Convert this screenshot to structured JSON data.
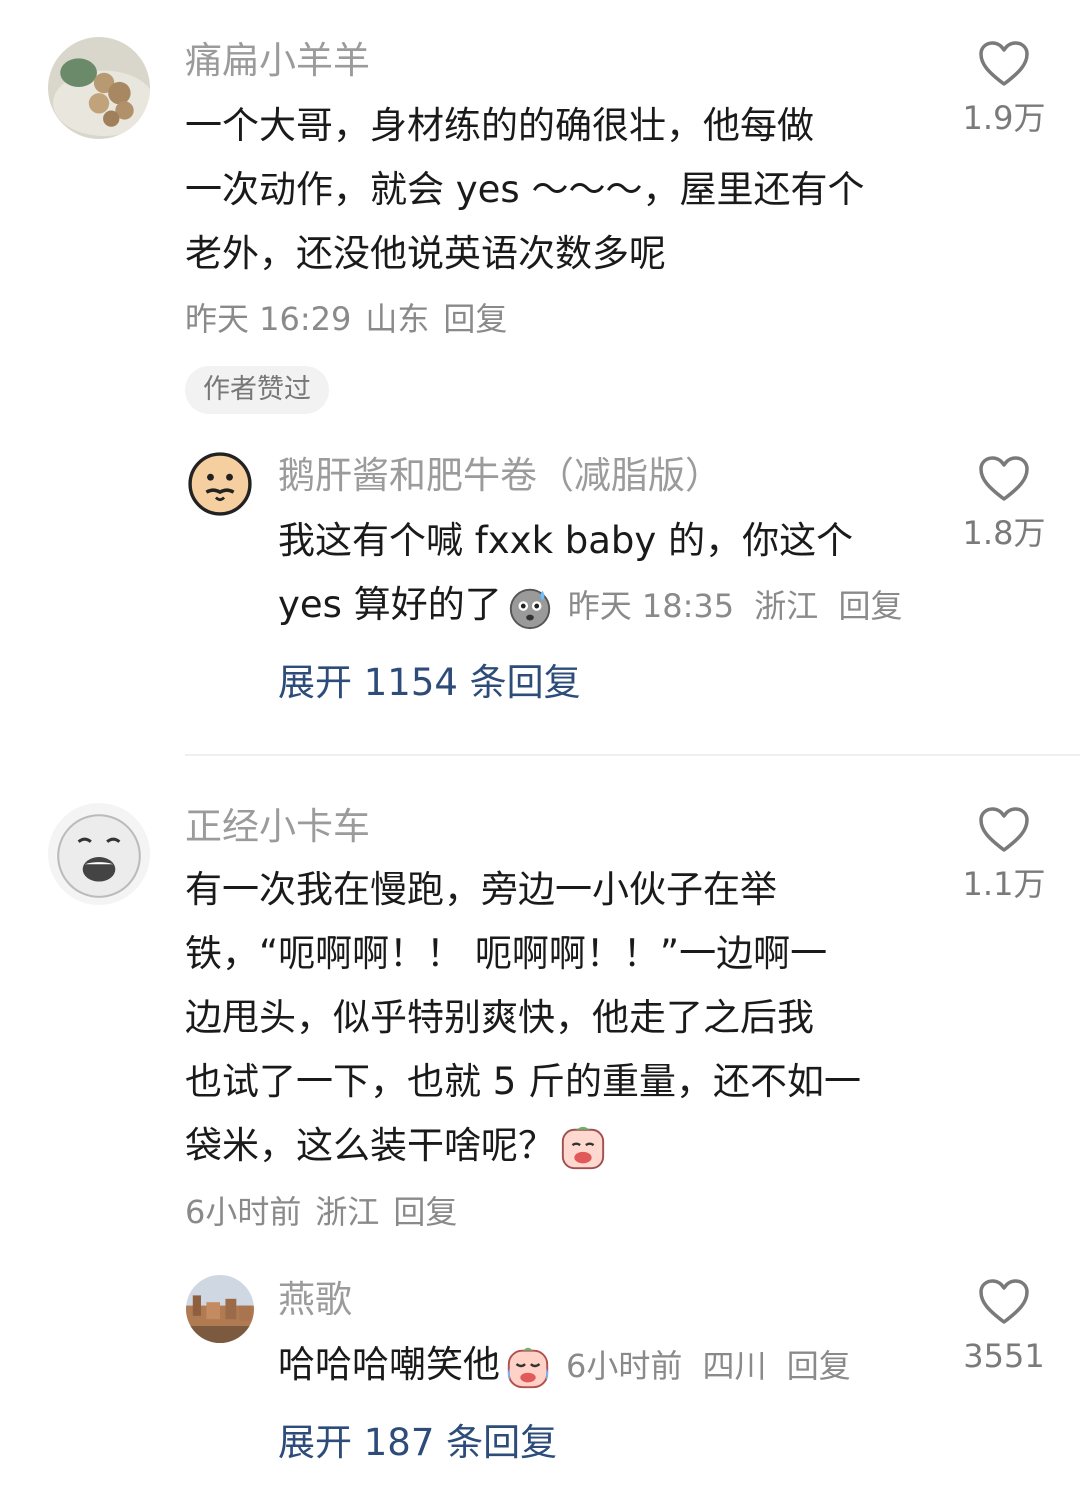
{
  "comments": [
    {
      "username": "痛扁小羊羊",
      "avatar_icon": "mushroom-plate-avatar",
      "text_lines": [
        "一个大哥，身材练的的确很壮，他每做",
        "一次动作，就会 yes ～～～，屋里还有个",
        "老外，还没他说英语次数多呢"
      ],
      "time": "昨天 16:29",
      "location": "山东",
      "reply_label": "回复",
      "likes": "1.9万",
      "badge": "作者赞过",
      "reply": {
        "username": "鹅肝酱和肥牛卷（减脂版）",
        "avatar_icon": "cartoon-face-avatar",
        "text_lines": [
          "我这有个喊 fxxk baby 的，你这个",
          "yes 算好的了"
        ],
        "emoji_icon": "nervous-sweat-emoji",
        "time": "昨天 18:35",
        "location": "浙江",
        "reply_label": "回复",
        "likes": "1.8万"
      },
      "expand_label": "展开 1154 条回复"
    },
    {
      "username": "正经小卡车",
      "avatar_icon": "laughing-meme-face-avatar",
      "text_lines": [
        "有一次我在慢跑，旁边一小伙子在举",
        "铁，“呃啊啊！！ 呃啊啊！！”一边啊一",
        "边甩头，似乎特别爽快，他走了之后我",
        "也试了一下，也就 5 斤的重量，还不如一",
        "袋米，这么装干啥呢？"
      ],
      "emoji_icon": "crying-peach-emoji",
      "time": "6小时前",
      "location": "浙江",
      "reply_label": "回复",
      "likes": "1.1万",
      "reply": {
        "username": "燕歌",
        "avatar_icon": "city-landscape-avatar",
        "text_lines": [
          "哈哈哈嘲笑他"
        ],
        "emoji_icon": "laughing-tears-emoji",
        "time": "6小时前",
        "location": "四川",
        "reply_label": "回复",
        "likes": "3551"
      },
      "expand_label": "展开 187 条回复"
    }
  ],
  "colors": {
    "link": "#2d4c7a",
    "muted": "#8a8a8a",
    "name": "#9b9b9b"
  }
}
